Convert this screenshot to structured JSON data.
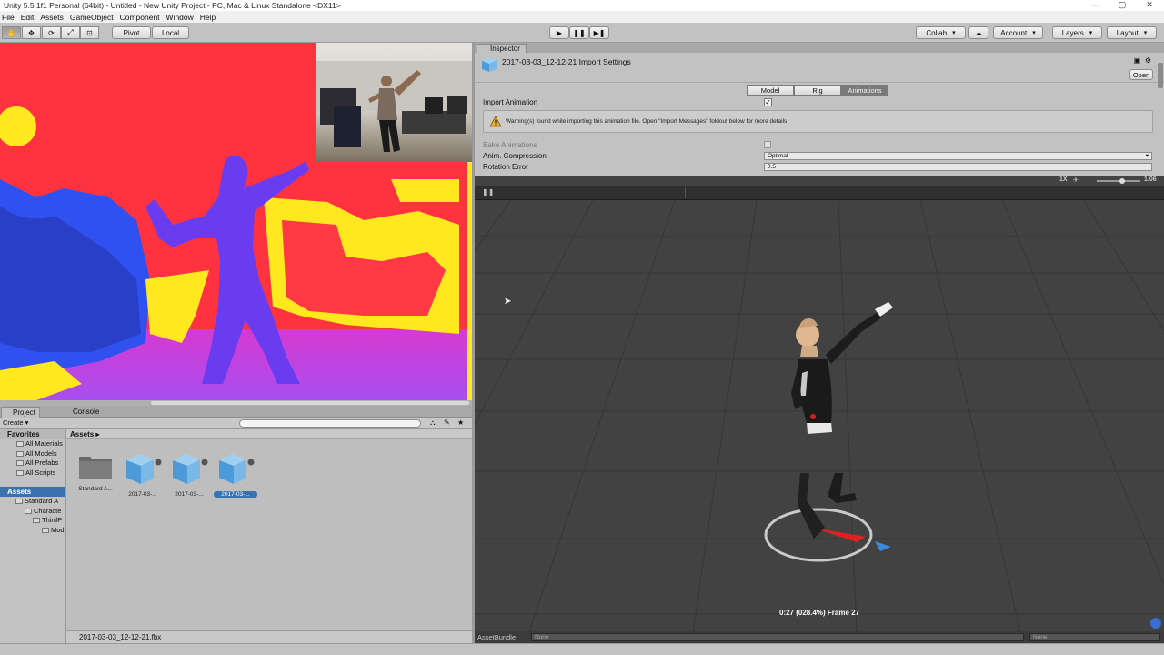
{
  "window": {
    "title": "Unity 5.5.1f1 Personal (64bit) - Untitled - New Unity Project - PC, Mac & Linux Standalone <DX11>",
    "minimize": "—",
    "maximize": "▢",
    "close": "✕"
  },
  "menu": [
    "File",
    "Edit",
    "Assets",
    "GameObject",
    "Component",
    "Window",
    "Help"
  ],
  "toolbar": {
    "pivot": "Pivot",
    "local": "Local",
    "collab": "Collab",
    "account": "Account",
    "layers": "Layers",
    "layout": "Layout"
  },
  "project": {
    "tab_project": "Project",
    "tab_console": "Console",
    "create": "Create",
    "favorites_header": "Favorites",
    "favorites": [
      "All Materials",
      "All Models",
      "All Prefabs",
      "All Scripts"
    ],
    "assets_header": "Assets",
    "tree": [
      "Standard A",
      "Characte",
      "ThirdP",
      "Mod"
    ],
    "breadcrumb": "Assets",
    "items": [
      "Standard A...",
      "2017-03-...",
      "2017-03-...",
      "2017-03-..."
    ],
    "selected_file": "2017-03-03_12-12-21.fbx"
  },
  "inspector": {
    "tab": "Inspector",
    "title": "2017-03-03_12-12-21 Import Settings",
    "open": "Open",
    "tabs": [
      "Model",
      "Rig",
      "Animations"
    ],
    "active_tab": "Animations",
    "import_animation_label": "Import Animation",
    "import_animation_checked": true,
    "warning": "Warning(s) found while importing this animation file. Open \"Import Messages\" foldout below for more details",
    "bake_animations_label": "Bake Animations",
    "anim_compression_label": "Anim. Compression",
    "anim_compression_value": "Optimal",
    "rotation_error_label": "Rotation Error",
    "rotation_error_value": "0.5"
  },
  "preview": {
    "speed_label": "1X",
    "speed_value": "1.06",
    "frame_label": "0:27 (028.4%) Frame 27",
    "asset_bundle_label": "AssetBundle",
    "bundle_name": "None",
    "bundle_variant": "None"
  },
  "colors": {
    "depth_background": "#ff3340",
    "depth_body": "#6a3cf0",
    "depth_near": "#ffe820",
    "grid_background": "#424242"
  }
}
